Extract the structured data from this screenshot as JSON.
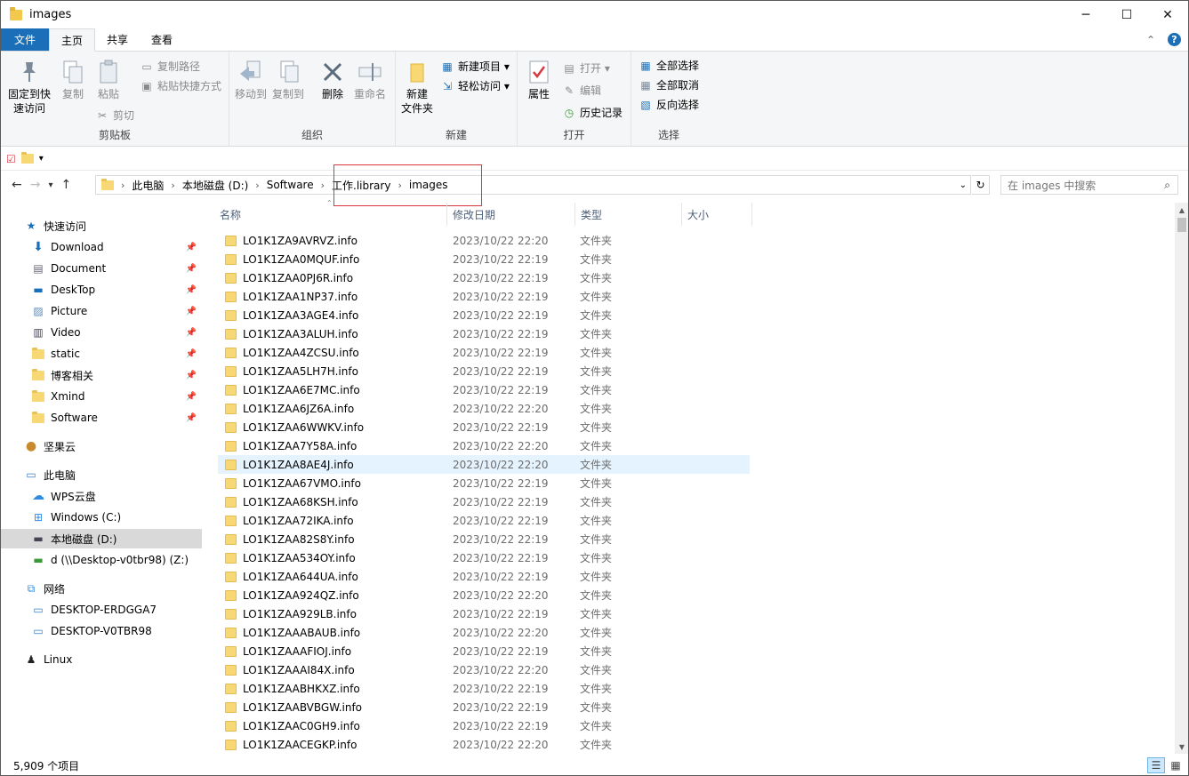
{
  "window": {
    "title": "images",
    "minimize": "─",
    "maximize": "☐",
    "close": "✕"
  },
  "tabs": {
    "file": "文件",
    "home": "主页",
    "share": "共享",
    "view": "查看",
    "collapse": "⌃",
    "help": "?"
  },
  "ribbon": {
    "clipboard": {
      "name": "剪贴板",
      "pin": "固定到快\n速访问",
      "pin_l1": "固定到快",
      "pin_l2": "速访问",
      "copy": "复制",
      "paste": "粘贴",
      "copy_path": "复制路径",
      "paste_shortcut": "粘贴快捷方式",
      "cut": "剪切"
    },
    "organize": {
      "name": "组织",
      "move_to": "移动到",
      "copy_to": "复制到",
      "delete": "删除",
      "rename": "重命名"
    },
    "new": {
      "name": "新建",
      "new_folder_l1": "新建",
      "new_folder_l2": "文件夹",
      "new_item": "新建项目 ▾",
      "easy_access": "轻松访问 ▾"
    },
    "open": {
      "name": "打开",
      "properties": "属性",
      "open": "打开 ▾",
      "edit": "编辑",
      "history": "历史记录"
    },
    "select": {
      "name": "选择",
      "select_all": "全部选择",
      "select_none": "全部取消",
      "invert": "反向选择"
    }
  },
  "address": {
    "crumbs": [
      "此电脑",
      "本地磁盘 (D:)",
      "Software",
      "工作.library",
      "images"
    ],
    "search_placeholder": "在 images 中搜索"
  },
  "navpane": {
    "quick_access": "快速访问",
    "quick_items": [
      "Download",
      "Document",
      "DeskTop",
      "Picture",
      "Video",
      "static",
      "博客相关",
      "Xmind",
      "Software"
    ],
    "nutstore": "坚果云",
    "this_pc": "此电脑",
    "pc_items": [
      "WPS云盘",
      "Windows (C:)",
      "本地磁盘 (D:)",
      "d (\\\\Desktop-v0tbr98) (Z:)"
    ],
    "network": "网络",
    "network_items": [
      "DESKTOP-ERDGGA7",
      "DESKTOP-V0TBR98"
    ],
    "linux": "Linux"
  },
  "columns": {
    "name": "名称",
    "modified": "修改日期",
    "type": "类型",
    "size": "大小"
  },
  "files": [
    {
      "name": "LO1K1ZA9AVRVZ.info",
      "date": "2023/10/22 22:20",
      "type": "文件夹"
    },
    {
      "name": "LO1K1ZAA0MQUF.info",
      "date": "2023/10/22 22:19",
      "type": "文件夹"
    },
    {
      "name": "LO1K1ZAA0PJ6R.info",
      "date": "2023/10/22 22:19",
      "type": "文件夹"
    },
    {
      "name": "LO1K1ZAA1NP37.info",
      "date": "2023/10/22 22:19",
      "type": "文件夹"
    },
    {
      "name": "LO1K1ZAA3AGE4.info",
      "date": "2023/10/22 22:19",
      "type": "文件夹"
    },
    {
      "name": "LO1K1ZAA3ALUH.info",
      "date": "2023/10/22 22:19",
      "type": "文件夹"
    },
    {
      "name": "LO1K1ZAA4ZCSU.info",
      "date": "2023/10/22 22:19",
      "type": "文件夹"
    },
    {
      "name": "LO1K1ZAA5LH7H.info",
      "date": "2023/10/22 22:19",
      "type": "文件夹"
    },
    {
      "name": "LO1K1ZAA6E7MC.info",
      "date": "2023/10/22 22:19",
      "type": "文件夹"
    },
    {
      "name": "LO1K1ZAA6JZ6A.info",
      "date": "2023/10/22 22:20",
      "type": "文件夹"
    },
    {
      "name": "LO1K1ZAA6WWKV.info",
      "date": "2023/10/22 22:19",
      "type": "文件夹"
    },
    {
      "name": "LO1K1ZAA7Y58A.info",
      "date": "2023/10/22 22:20",
      "type": "文件夹"
    },
    {
      "name": "LO1K1ZAA8AE4J.info",
      "date": "2023/10/22 22:20",
      "type": "文件夹"
    },
    {
      "name": "LO1K1ZAA67VMO.info",
      "date": "2023/10/22 22:19",
      "type": "文件夹"
    },
    {
      "name": "LO1K1ZAA68KSH.info",
      "date": "2023/10/22 22:19",
      "type": "文件夹"
    },
    {
      "name": "LO1K1ZAA72IKA.info",
      "date": "2023/10/22 22:19",
      "type": "文件夹"
    },
    {
      "name": "LO1K1ZAA82S8Y.info",
      "date": "2023/10/22 22:19",
      "type": "文件夹"
    },
    {
      "name": "LO1K1ZAA534OY.info",
      "date": "2023/10/22 22:19",
      "type": "文件夹"
    },
    {
      "name": "LO1K1ZAA644UA.info",
      "date": "2023/10/22 22:19",
      "type": "文件夹"
    },
    {
      "name": "LO1K1ZAA924QZ.info",
      "date": "2023/10/22 22:20",
      "type": "文件夹"
    },
    {
      "name": "LO1K1ZAA929LB.info",
      "date": "2023/10/22 22:19",
      "type": "文件夹"
    },
    {
      "name": "LO1K1ZAAABAUB.info",
      "date": "2023/10/22 22:20",
      "type": "文件夹"
    },
    {
      "name": "LO1K1ZAAAFIOJ.info",
      "date": "2023/10/22 22:19",
      "type": "文件夹"
    },
    {
      "name": "LO1K1ZAAAI84X.info",
      "date": "2023/10/22 22:20",
      "type": "文件夹"
    },
    {
      "name": "LO1K1ZAABHKXZ.info",
      "date": "2023/10/22 22:19",
      "type": "文件夹"
    },
    {
      "name": "LO1K1ZAABVBGW.info",
      "date": "2023/10/22 22:19",
      "type": "文件夹"
    },
    {
      "name": "LO1K1ZAAC0GH9.info",
      "date": "2023/10/22 22:19",
      "type": "文件夹"
    },
    {
      "name": "LO1K1ZAACEGKP.info",
      "date": "2023/10/22 22:20",
      "type": "文件夹"
    }
  ],
  "status": {
    "count": "5,909 个项目"
  },
  "colors": {
    "file_tab": "#1a6fb8",
    "highlight_row": "#e5f3ff",
    "red_box": "#d9363e",
    "folder": "#f8d775"
  }
}
